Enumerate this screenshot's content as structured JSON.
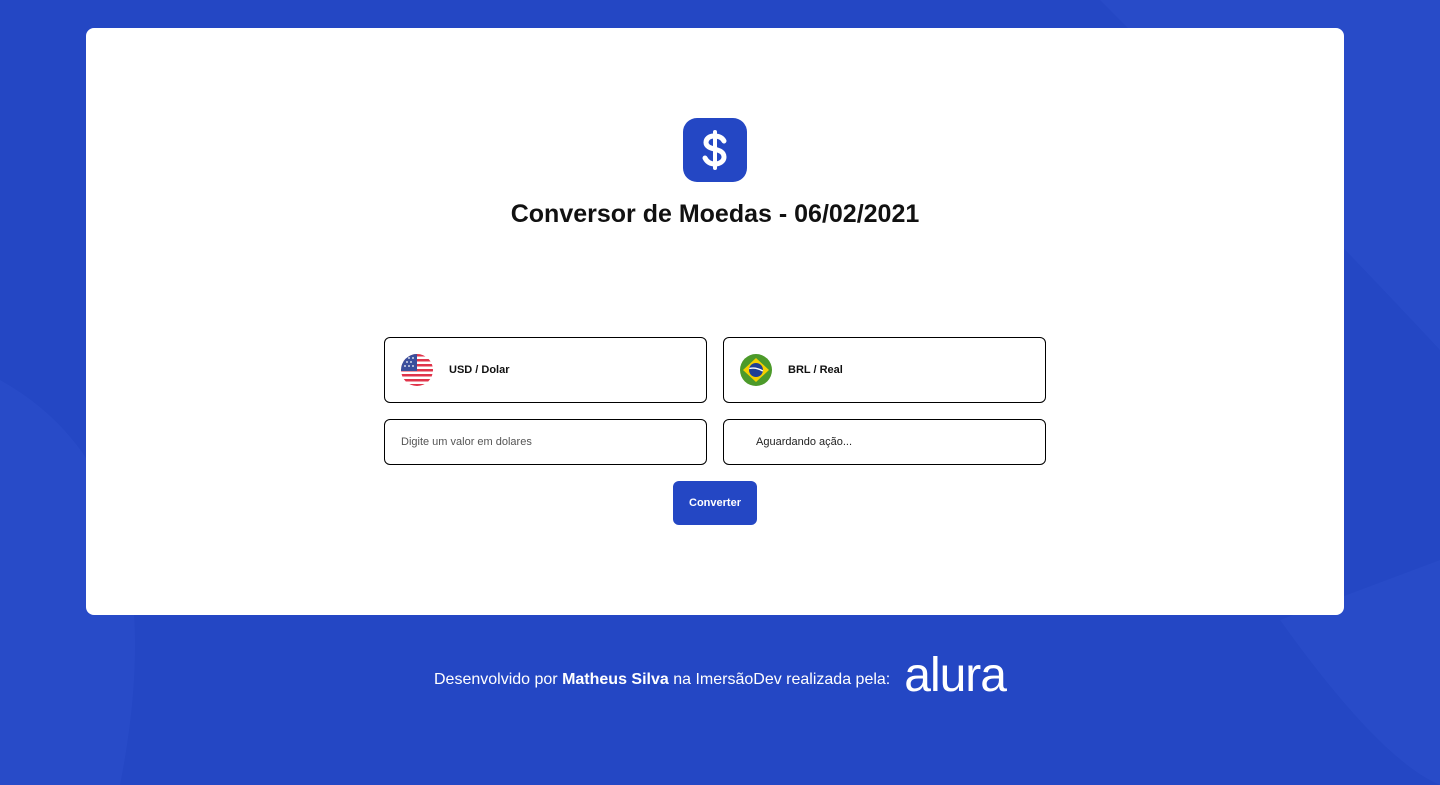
{
  "colors": {
    "brand_blue": "#2447c4",
    "card_bg": "#ffffff",
    "text_dark": "#111111"
  },
  "header": {
    "logo_icon": "dollar-icon",
    "title": "Conversor de Moedas - 06/02/2021"
  },
  "converter": {
    "from_currency": {
      "flag": "us-flag-icon",
      "label": "USD / Dolar"
    },
    "to_currency": {
      "flag": "br-flag-icon",
      "label": "BRL / Real"
    },
    "amount_input": {
      "placeholder": "Digite um valor em dolares",
      "value": ""
    },
    "result_text": "Aguardando ação...",
    "convert_label": "Converter"
  },
  "footer": {
    "prefix": "Desenvolvido por",
    "author": "Matheus Silva",
    "suffix": "na ImersãoDev realizada pela:",
    "brand": "alura"
  }
}
